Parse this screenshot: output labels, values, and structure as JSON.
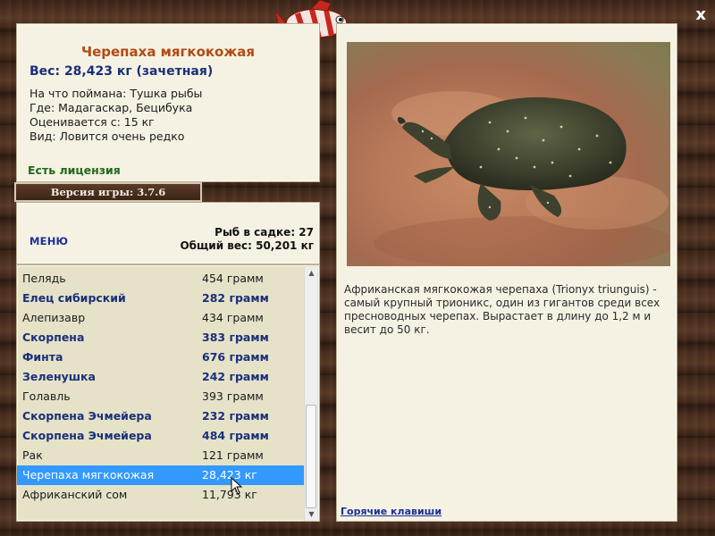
{
  "info": {
    "fish_name": "Черепаха мягкокожая",
    "weight": "Вес: 28,423 кг (зачетная)",
    "bait": "На что поймана: Тушка рыбы",
    "location": "Где: Мадагаскар, Бецибука",
    "valued_from": "Оценивается с: 15 кг",
    "kind": "Вид: Ловится очень редко",
    "license": "Есть лицензия"
  },
  "version": "Версия игры: 3.7.6",
  "menu": {
    "label": "МЕНЮ",
    "fish_in_cage": "Рыб в садке: 27",
    "total_weight": "Общий вес: 50,201 кг"
  },
  "catch_list": [
    {
      "name": "Пелядь",
      "weight": "454 грамм",
      "style": "normal"
    },
    {
      "name": "Елец сибирский",
      "weight": "282 грамм",
      "style": "bold"
    },
    {
      "name": "Алепизавр",
      "weight": "434 грамм",
      "style": "normal"
    },
    {
      "name": "Скорпена",
      "weight": "383 грамм",
      "style": "bold"
    },
    {
      "name": "Финта",
      "weight": "676 грамм",
      "style": "bold"
    },
    {
      "name": "Зеленушка",
      "weight": "242 грамм",
      "style": "bold"
    },
    {
      "name": "Голавль",
      "weight": "393 грамм",
      "style": "normal"
    },
    {
      "name": "Скорпена Эчмейера",
      "weight": "232 грамм",
      "style": "bold"
    },
    {
      "name": "Скорпена Эчмейера",
      "weight": "484 грамм",
      "style": "bold"
    },
    {
      "name": "Рак",
      "weight": "121 грамм",
      "style": "normal"
    },
    {
      "name": "Черепаха мягкокожая",
      "weight": "28,423 кг",
      "style": "selected"
    },
    {
      "name": "Африканский сом",
      "weight": "11,793 кг",
      "style": "normal"
    }
  ],
  "description": "Африканская мягкокожая черепаха (Trionyx triunguis) - самый крупный трионикс, один из гигантов среди всех пресноводных черепах. Вырастает в длину до 1,2 м и весит до 50 кг.",
  "hotkeys": "Горячие клавиши",
  "close": "x",
  "colors": {
    "title": "#b24a14",
    "highlight_text": "#1a2f7a",
    "license": "#1f6a1b",
    "selection": "#3399ff",
    "panel": "#f5f2e3"
  },
  "icons": {
    "logo": "fish-logo-icon",
    "close": "close-icon",
    "photo": "soft-shell-turtle-photo"
  }
}
